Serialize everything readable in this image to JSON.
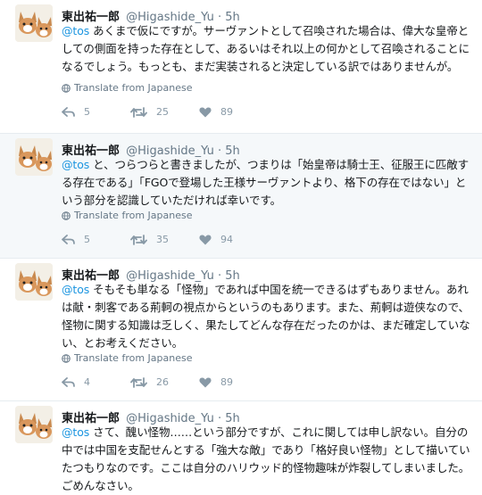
{
  "tweets": [
    {
      "name": "東出祐一郎",
      "handle": "@Higashide_Yu",
      "dot": "·",
      "time": "5h",
      "mention": "@tos",
      "text": "あくまで仮にですが。サーヴァントとして召喚された場合は、偉大な皇帝としての側面を持った存在として、あるいはそれ以上の何かとして召喚されることになるでしょう。もっとも、まだ実装されると決定している訳ではありませんが。",
      "translate": "Translate from Japanese",
      "replies": "5",
      "retweets": "25",
      "likes": "89"
    },
    {
      "name": "東出祐一郎",
      "handle": "@Higashide_Yu",
      "dot": "·",
      "time": "5h",
      "mention": "@tos",
      "text": "と、つらつらと書きましたが、つまりは「始皇帝は騎士王、征服王に匹敵する存在である」「FGOで登場した王様サーヴァントより、格下の存在ではない」という部分を認識していただければ幸いです。",
      "translate": "Translate from Japanese",
      "replies": "5",
      "retweets": "35",
      "likes": "94"
    },
    {
      "name": "東出祐一郎",
      "handle": "@Higashide_Yu",
      "dot": "·",
      "time": "5h",
      "mention": "@tos",
      "text": "そもそも単なる「怪物」であれば中国を統一できるはずもありません。あれは献・刺客である荊軻の視点からというのもあります。また、荊軻は遊侠なので、怪物に関する知識は乏しく、果たしてどんな存在だったのかは、まだ確定していない、とお考えください。",
      "translate": "Translate from Japanese",
      "replies": "4",
      "retweets": "26",
      "likes": "89"
    },
    {
      "name": "東出祐一郎",
      "handle": "@Higashide_Yu",
      "dot": "·",
      "time": "5h",
      "mention": "@tos",
      "text": "さて、醜い怪物……という部分ですが、これに関しては申し訳ない。自分の中では中国を支配せんとする「強大な敵」であり「格好良い怪物」として描いていたつもりなのです。ここは自分のハリウッド的怪物趣味が炸裂してしまいました。ごめんなさい。"
    }
  ],
  "icons": {
    "avatar": "corgi-avatar",
    "translate": "globe-icon",
    "reply": "reply-arrow-icon",
    "retweet": "retweet-icon",
    "like": "heart-icon"
  },
  "colors": {
    "link": "#1b95e0",
    "muted": "#657786",
    "icon": "#8899a6",
    "highlight_bg": "#f5f8fa"
  }
}
